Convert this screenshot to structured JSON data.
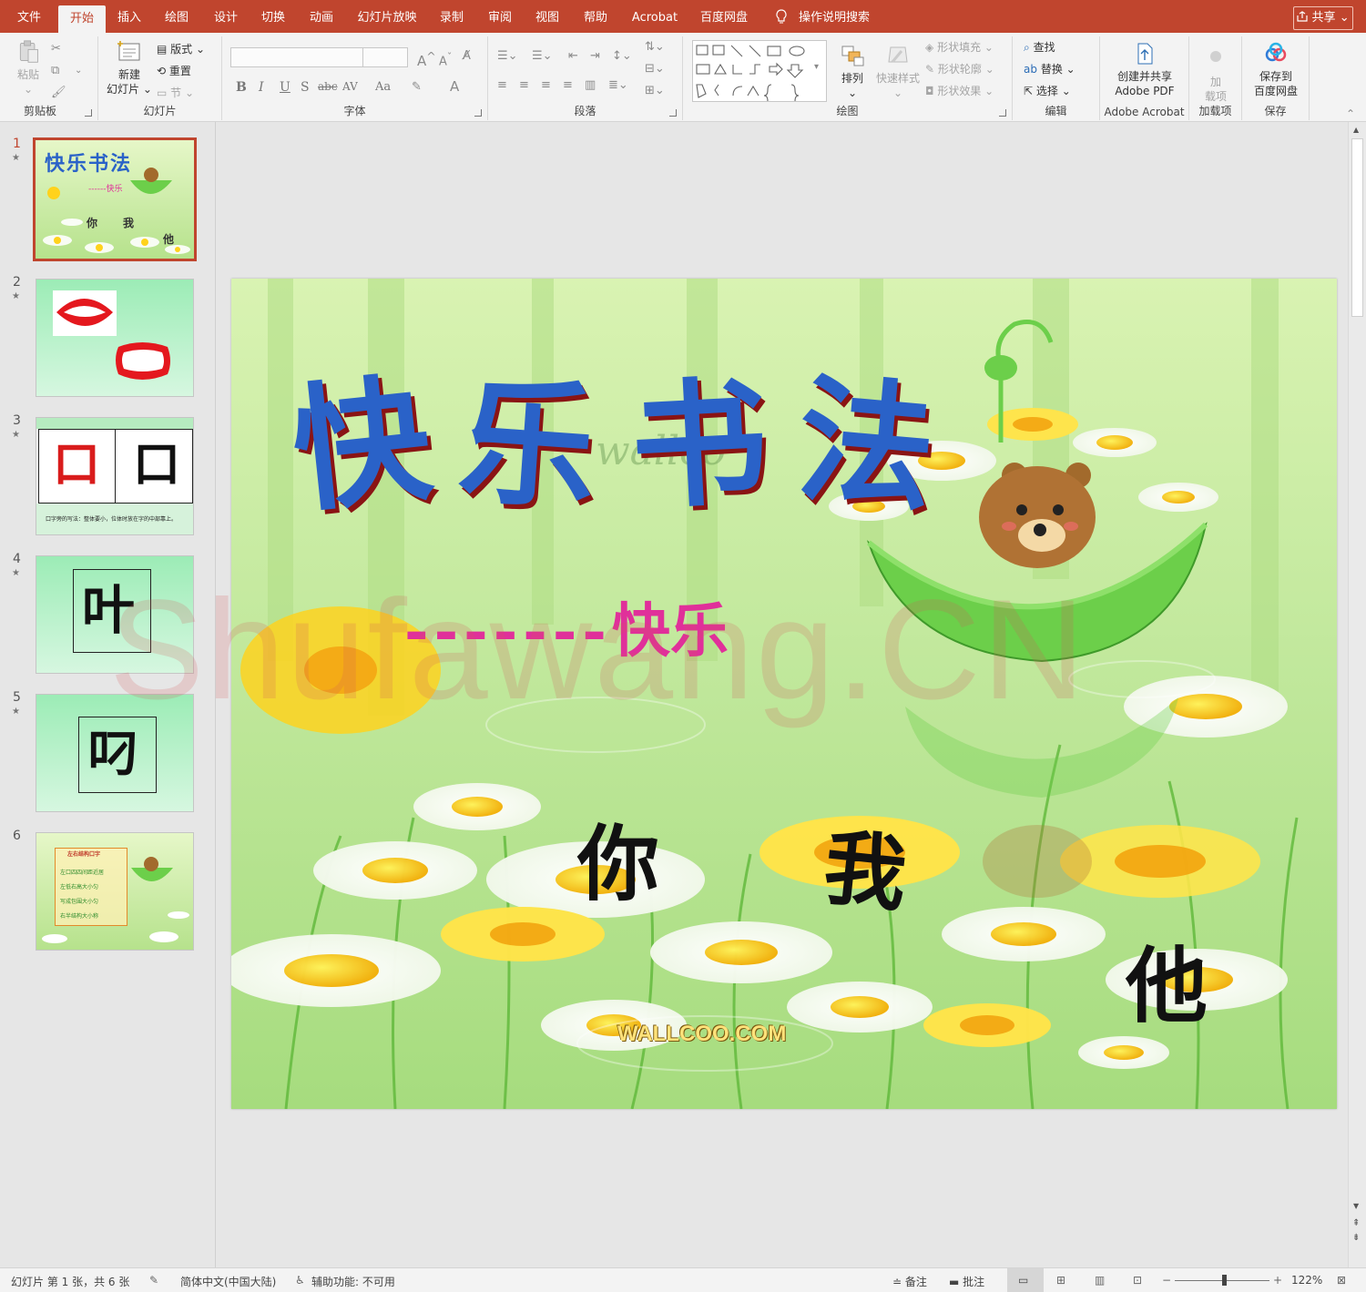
{
  "tabs": [
    {
      "label": "文件"
    },
    {
      "label": "开始"
    },
    {
      "label": "插入"
    },
    {
      "label": "绘图"
    },
    {
      "label": "设计"
    },
    {
      "label": "切换"
    },
    {
      "label": "动画"
    },
    {
      "label": "幻灯片放映"
    },
    {
      "label": "录制"
    },
    {
      "label": "审阅"
    },
    {
      "label": "视图"
    },
    {
      "label": "帮助"
    },
    {
      "label": "Acrobat"
    },
    {
      "label": "百度网盘"
    }
  ],
  "tell_me": "操作说明搜索",
  "share": "共享",
  "ribbon": {
    "clipboard": {
      "group": "剪贴板",
      "paste": "粘贴"
    },
    "slides": {
      "group": "幻灯片",
      "new_slide": "新建",
      "new_slide_2": "幻灯片",
      "layout": "版式",
      "reset": "重置",
      "section": "节"
    },
    "font": {
      "group": "字体",
      "bold": "B",
      "italic": "I",
      "underline": "U",
      "shadow": "S",
      "strike": "abc",
      "spacing": "AV",
      "case": "Aa"
    },
    "paragraph": {
      "group": "段落"
    },
    "drawing": {
      "group": "绘图",
      "arrange": "排列",
      "quick_styles": "快速样式",
      "shape_fill": "形状填充",
      "shape_outline": "形状轮廓",
      "shape_effects": "形状效果"
    },
    "editing": {
      "group": "编辑",
      "find": "查找",
      "replace": "替换",
      "select": "选择"
    },
    "acrobat": {
      "group": "Adobe Acrobat",
      "create": "创建并共享",
      "create_2": "Adobe PDF"
    },
    "addins": {
      "group": "加载项",
      "addin": "加",
      "addin_2": "载项"
    },
    "save": {
      "group": "保存",
      "save_to": "保存到",
      "save_to_2": "百度网盘"
    }
  },
  "thumbnails": [
    {
      "num": "1",
      "title": "快乐书法",
      "sub": "------快乐",
      "chars": [
        "你",
        "我",
        "他"
      ]
    },
    {
      "num": "2"
    },
    {
      "num": "3",
      "chars": [
        "口",
        "口"
      ],
      "caption": "口字旁的写法：整体要小，位体时放在字的中部靠上。"
    },
    {
      "num": "4",
      "char": "叶"
    },
    {
      "num": "5",
      "char": "叼"
    },
    {
      "num": "6",
      "lines": [
        "左右结构口字",
        "左口四四间距近居",
        "左低右高大小匀",
        "写成包围大小匀",
        "右半结构大小称"
      ]
    }
  ],
  "slide": {
    "title": [
      "快",
      "乐",
      "书",
      "法"
    ],
    "dashes": "-------",
    "subtitle": "快乐",
    "chars": [
      "你",
      "我",
      "他"
    ],
    "bg_text": "wallco",
    "brand": "WALLCOO.COM"
  },
  "watermark": "Shufawang.CN",
  "status": {
    "slide": "幻灯片 第 1 张，共 6 张",
    "lang": "简体中文(中国大陆)",
    "access": "辅助功能: 不可用",
    "notes": "备注",
    "comments": "批注",
    "zoom": "122%"
  },
  "colors": {
    "accent": "#c0452e",
    "title_blue": "#2a62c8",
    "subtitle_pink": "#e0309a"
  }
}
